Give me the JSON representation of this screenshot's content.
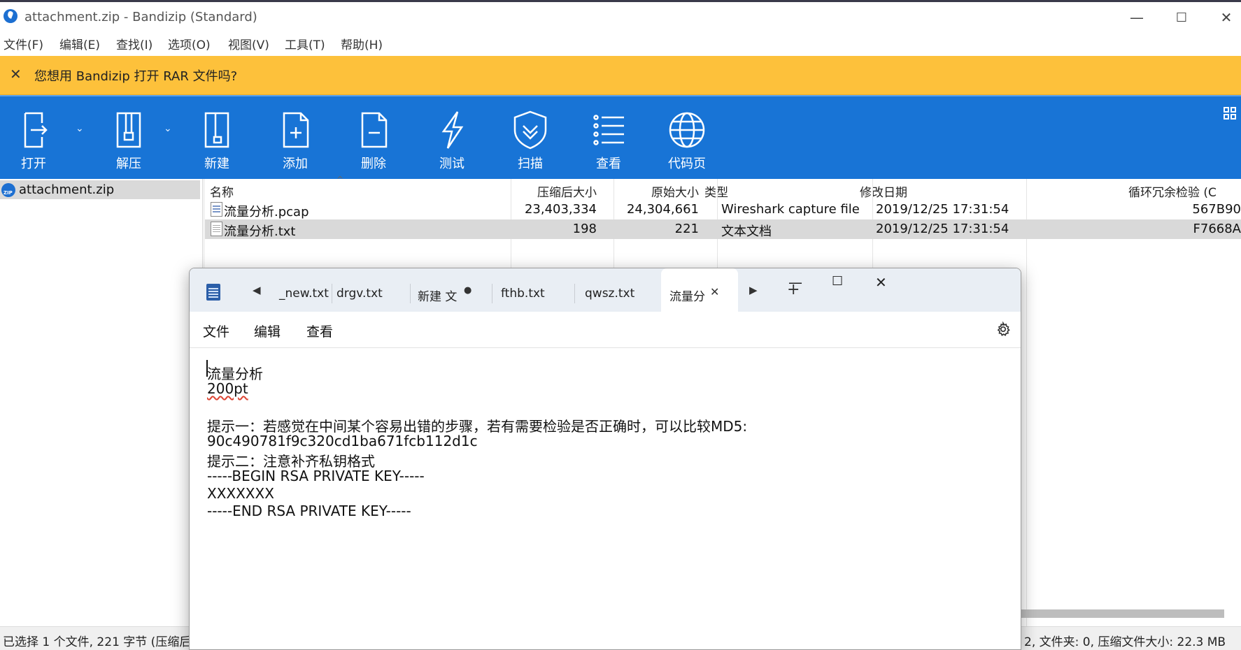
{
  "window": {
    "title": "attachment.zip - Bandizip (Standard)",
    "controls": [
      "—",
      "☐",
      "✕"
    ]
  },
  "menu": [
    "文件(F)",
    "编辑(E)",
    "查找(I)",
    "选项(O)",
    "视图(V)",
    "工具(T)",
    "帮助(H)"
  ],
  "notice": {
    "close": "✕",
    "text": "您想用 Bandizip 打开 RAR 文件吗?"
  },
  "toolbar": {
    "buttons": [
      "打开",
      "解压",
      "新建",
      "添加",
      "删除",
      "测试",
      "扫描",
      "查看",
      "代码页"
    ]
  },
  "sidebar": {
    "archive": "attachment.zip"
  },
  "filelist": {
    "columns": [
      "名称",
      "压缩后大小",
      "原始大小",
      "类型",
      "修改日期",
      "循环冗余检验 (C"
    ],
    "rows": [
      {
        "name": "流量分析.pcap",
        "packed": "23,403,334",
        "size": "24,304,661",
        "type": "Wireshark capture file",
        "modified": "2019/12/25 17:31:54",
        "crc": "567B90"
      },
      {
        "name": "流量分析.txt",
        "packed": "198",
        "size": "221",
        "type": "文本文档",
        "modified": "2019/12/25 17:31:54",
        "crc": "F7668A"
      }
    ]
  },
  "status": {
    "left": "已选择 1 个文件, 221 字节 (压缩后",
    "right": "2, 文件夹: 0, 压缩文件大小: 22.3 MB"
  },
  "notepad": {
    "tabs": [
      "_new.txt",
      "drgv.txt",
      "新建 文",
      "fthb.txt",
      "qwsz.txt",
      "流量分"
    ],
    "unsaved_dot": "●",
    "tab_close": "✕",
    "nav_left": "◀",
    "nav_right": "▶",
    "new_tab": "+",
    "controls": [
      "—",
      "☐",
      "✕"
    ],
    "menu": [
      "文件",
      "编辑",
      "查看"
    ],
    "lines": [
      "流量分析",
      "200pt",
      "",
      "提示一：若感觉在中间某个容易出错的步骤，若有需要检验是否正确时，可以比较MD5:",
      "90c490781f9c320cd1ba671fcb112d1c",
      "提示二：注意补齐私钥格式",
      "-----BEGIN RSA PRIVATE KEY-----",
      "XXXXXXX",
      "-----END RSA PRIVATE KEY-----"
    ]
  }
}
